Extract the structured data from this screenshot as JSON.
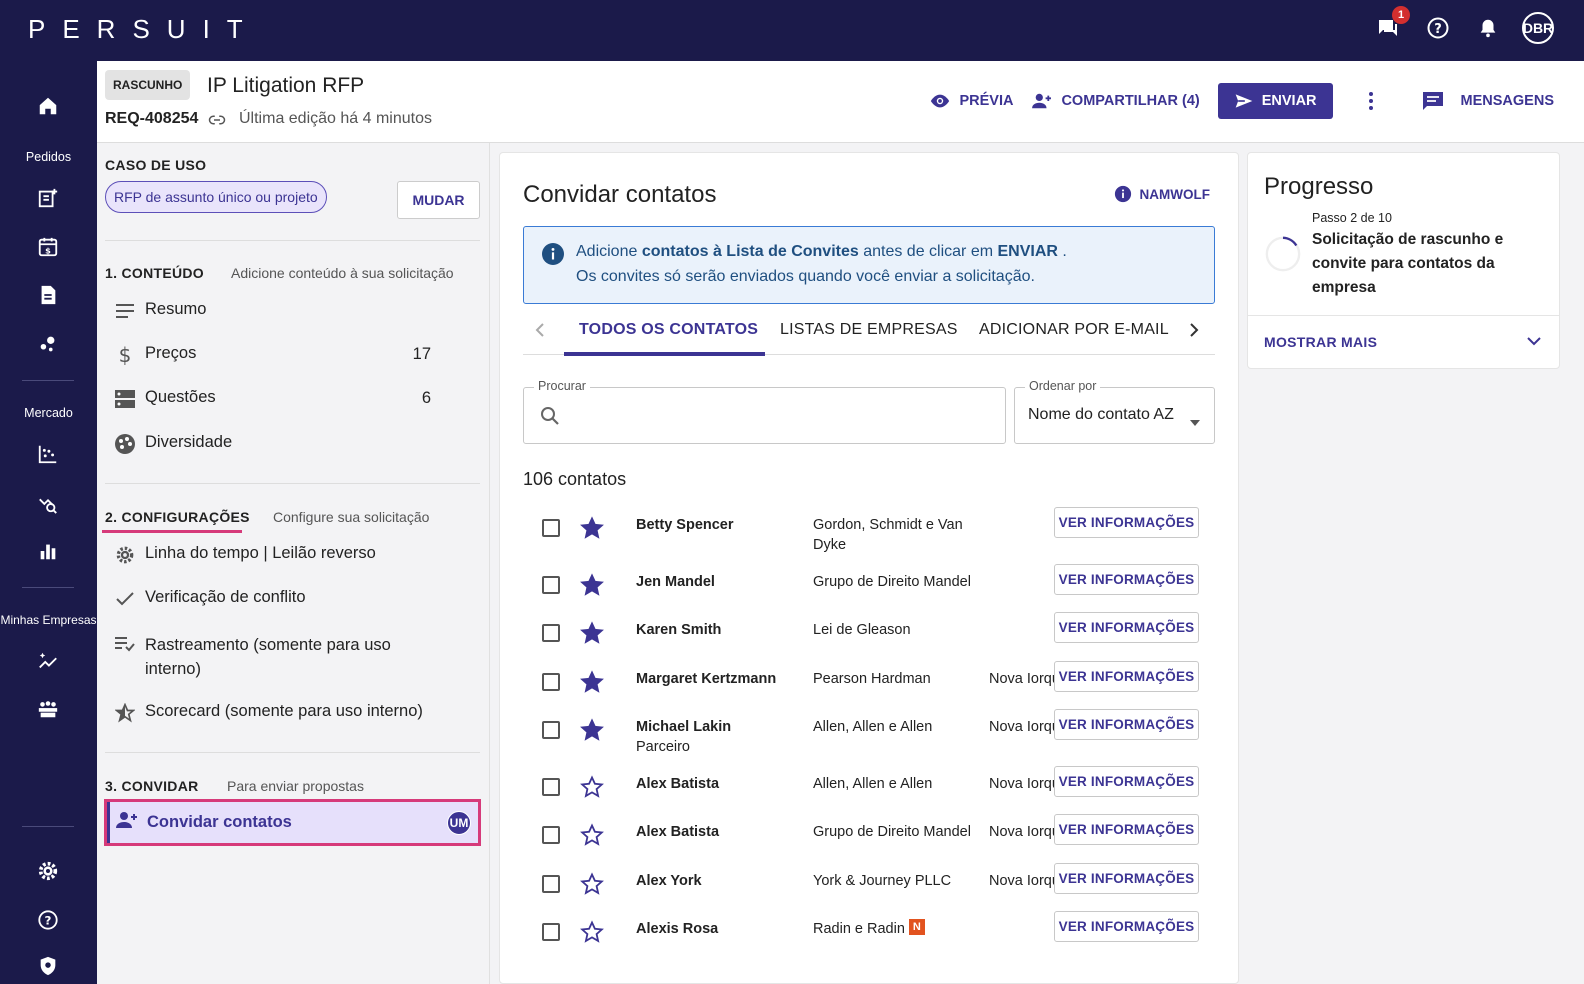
{
  "app": {
    "logo": "PERSUIT",
    "notif_count": "1",
    "user_initials": "DBR"
  },
  "nav": {
    "pedidos": "Pedidos",
    "mercado": "Mercado",
    "minhas_empresas": "Minhas Empresas"
  },
  "header": {
    "status_chip": "RASCUNHO",
    "title": "IP Litigation RFP",
    "req_id": "REQ-408254",
    "last_edit": "Última edição há 4 minutos",
    "preview_label": "PRÉVIA",
    "share_label": "COMPARTILHAR (4)",
    "send_label": "ENVIAR",
    "messages_label": "MENSAGENS"
  },
  "left": {
    "usecase_title": "CASO DE USO",
    "usecase_chip": "RFP de assunto único ou projeto",
    "change_label": "MUDAR",
    "s1_title": "1. CONTEÚDO",
    "s1_sub": "Adicione conteúdo à sua solicitação",
    "s1_items": [
      {
        "label": "Resumo",
        "count": ""
      },
      {
        "label": "Preços",
        "count": "17"
      },
      {
        "label": "Questões",
        "count": "6"
      },
      {
        "label": "Diversidade",
        "count": ""
      }
    ],
    "s2_title": "2. CONFIGURAÇÕES",
    "s2_sub": "Configure sua solicitação",
    "s2_items": [
      {
        "label": "Linha do tempo | Leilão reverso"
      },
      {
        "label": "Verificação de conflito"
      },
      {
        "label": "Rastreamento (somente para uso interno)"
      },
      {
        "label": "Scorecard (somente para uso interno)"
      }
    ],
    "s3_title": "3. CONVIDAR",
    "s3_sub": "Para enviar propostas",
    "invite_label": "Convidar contatos",
    "invite_badge": "UM"
  },
  "center": {
    "title": "Convidar contatos",
    "namwolf": "NAMWOLF",
    "info_line1_a": "Adicione ",
    "info_line1_b": "contatos à Lista de Convites",
    "info_line1_c": " antes de clicar em ",
    "info_line1_d": "ENVIAR",
    "info_line1_e": " .",
    "info_line2": "Os convites só serão enviados quando você enviar a solicitação.",
    "tabs": [
      "TODOS OS CONTATOS",
      "LISTAS DE EMPRESAS",
      "ADICIONAR POR E-MAIL"
    ],
    "search_label": "Procurar",
    "sort_label": "Ordenar por",
    "sort_value": "Nome do contato AZ",
    "count": "106 contatos",
    "view_label": "VER INFORMAÇÕES",
    "contacts": [
      {
        "name": "Betty Spencer",
        "role": "",
        "firm": "Gordon, Schmidt e Van Dyke",
        "city": "",
        "starred": true,
        "namwolf": false
      },
      {
        "name": "Jen Mandel",
        "role": "",
        "firm": "Grupo de Direito Mandel",
        "city": "",
        "starred": true,
        "namwolf": false
      },
      {
        "name": "Karen Smith",
        "role": "",
        "firm": "Lei de Gleason",
        "city": "",
        "starred": true,
        "namwolf": false
      },
      {
        "name": "Margaret Kertzmann",
        "role": "",
        "firm": "Pearson Hardman",
        "city": "Nova Iorque",
        "starred": true,
        "namwolf": false
      },
      {
        "name": "Michael Lakin",
        "role": "Parceiro",
        "firm": "Allen, Allen e Allen",
        "city": "Nova Iorque",
        "starred": true,
        "namwolf": false
      },
      {
        "name": "Alex Batista",
        "role": "",
        "firm": "Allen, Allen e Allen",
        "city": "Nova Iorque",
        "starred": false,
        "namwolf": false
      },
      {
        "name": "Alex Batista",
        "role": "",
        "firm": "Grupo de Direito Mandel",
        "city": "Nova Iorque",
        "starred": false,
        "namwolf": false
      },
      {
        "name": "Alex York",
        "role": "",
        "firm": "York & Journey PLLC",
        "city": "Nova Iorque",
        "starred": false,
        "namwolf": false
      },
      {
        "name": "Alexis Rosa",
        "role": "",
        "firm": "Radin e Radin",
        "city": "",
        "starred": false,
        "namwolf": true
      }
    ]
  },
  "progress": {
    "title": "Progresso",
    "step": "Passo 2 de 10",
    "desc": "Solicitação de rascunho e convite para contatos da empresa",
    "more": "MOSTRAR MAIS"
  },
  "colors": {
    "brand": "#3c3493",
    "nav_bg": "#1b1a4a",
    "highlight": "#d63a7a"
  }
}
